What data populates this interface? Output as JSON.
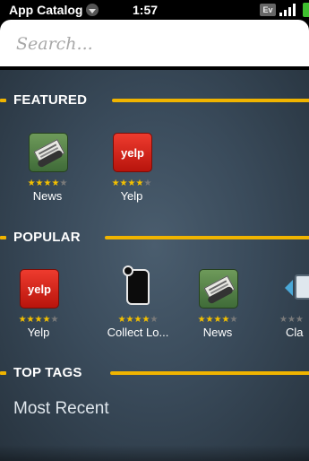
{
  "status_bar": {
    "app_title": "App Catalog",
    "time": "1:57",
    "network_badge": "Ev",
    "battery_color": "#3fbf2f"
  },
  "search": {
    "placeholder": "Search...",
    "value": ""
  },
  "sections": {
    "featured": {
      "title": "FEATURED",
      "apps": [
        {
          "name": "News",
          "icon": "newspaper-icon",
          "rating": "4 of 5"
        },
        {
          "name": "Yelp",
          "icon": "yelp-icon",
          "icon_text": "yelp",
          "rating": "4.5 of 5"
        }
      ]
    },
    "popular": {
      "title": "POPULAR",
      "apps": [
        {
          "name": "Yelp",
          "icon": "yelp-icon",
          "icon_text": "yelp",
          "rating": "4.5 of 5"
        },
        {
          "name": "Collect Lo...",
          "icon": "scroll-icon",
          "rating": "4.5 of 5"
        },
        {
          "name": "News",
          "icon": "newspaper-icon",
          "rating": "4 of 5"
        },
        {
          "name": "Cla",
          "icon": "device-arrow-icon",
          "rating": "partially visible"
        }
      ]
    },
    "top_tags": {
      "title": "TOP TAGS",
      "items": [
        "Most Recent"
      ]
    }
  },
  "colors": {
    "accent": "#f0b400",
    "star": "#f4c000",
    "background": "#3a4b5b"
  }
}
